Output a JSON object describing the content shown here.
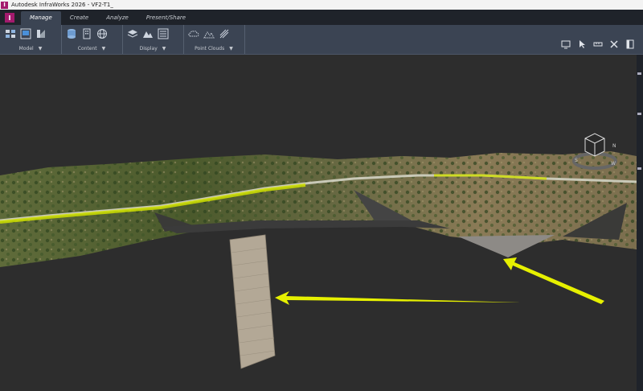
{
  "window": {
    "title": "Autodesk InfraWorks 2026 - VF2-T1_",
    "app_badge": "I"
  },
  "tabs": [
    {
      "label": "Manage",
      "active": true
    },
    {
      "label": "Create",
      "active": false
    },
    {
      "label": "Analyze",
      "active": false
    },
    {
      "label": "Present/Share",
      "active": false
    }
  ],
  "ribbon": {
    "groups": [
      {
        "label": "Model",
        "icons": [
          "model-explorer-icon",
          "screen-icon",
          "style-icon"
        ]
      },
      {
        "label": "Content",
        "icons": [
          "database-icon",
          "building-icon",
          "globe-icon"
        ]
      },
      {
        "label": "Display",
        "icons": [
          "layers-icon",
          "terrain-icon",
          "list-icon"
        ]
      },
      {
        "label": "Point Clouds",
        "icons": [
          "cloud-icon",
          "cloud-terrain-icon",
          "cloud-hatch-icon"
        ]
      }
    ],
    "right_tools": [
      "monitor-icon",
      "select-arrow-icon",
      "measure-icon",
      "tools-icon",
      "panel-icon"
    ]
  },
  "viewcube": {
    "compass": [
      "N",
      "E",
      "S",
      "W"
    ]
  },
  "colors": {
    "road_highlight": "#cfe000",
    "arrow": "#e6f000",
    "accent": "#a31a6d"
  }
}
